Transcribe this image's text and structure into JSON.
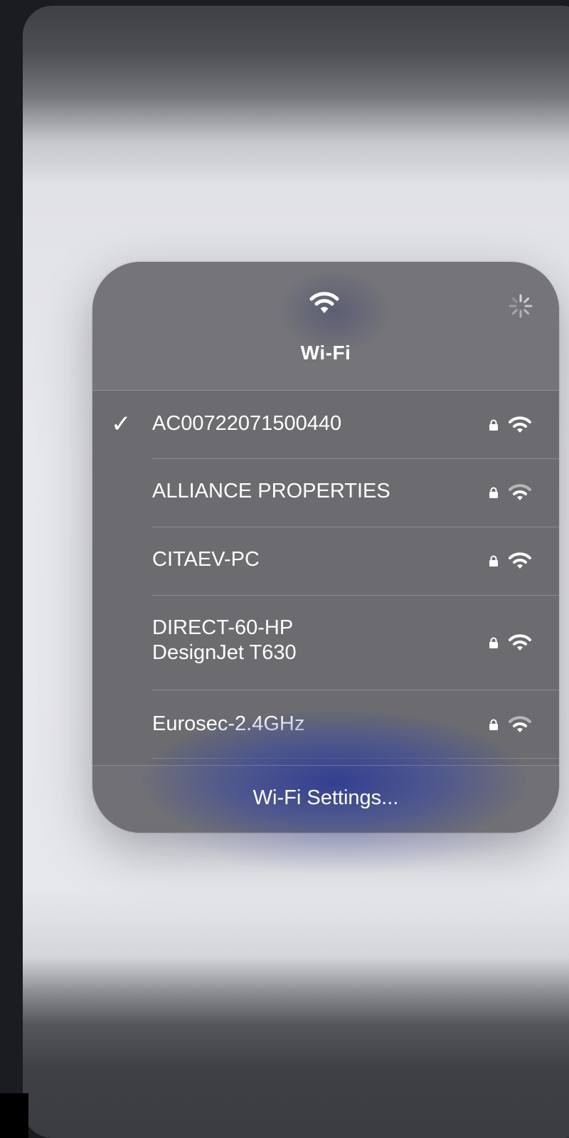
{
  "panel": {
    "title": "Wi-Fi",
    "header_icon": "wifi-icon",
    "status_icon": "loading-spinner-icon",
    "footer_label": "Wi-Fi Settings..."
  },
  "networks": [
    {
      "name": "AC00722071500440",
      "connected": true,
      "secured": true,
      "signal_bars": 3
    },
    {
      "name": "ALLIANCE PROPERTIES",
      "connected": false,
      "secured": true,
      "signal_bars": 2
    },
    {
      "name": "CITAEV-PC",
      "connected": false,
      "secured": true,
      "signal_bars": 3
    },
    {
      "name": "DIRECT-60-HP\nDesignJet T630",
      "connected": false,
      "secured": true,
      "signal_bars": 3
    },
    {
      "name": "Eurosec-2.4GHz",
      "connected": false,
      "secured": true,
      "signal_bars": 2
    }
  ],
  "colors": {
    "panel_background": "#6b6b70",
    "text": "#ffffff",
    "glow": "#2f3a8f"
  }
}
